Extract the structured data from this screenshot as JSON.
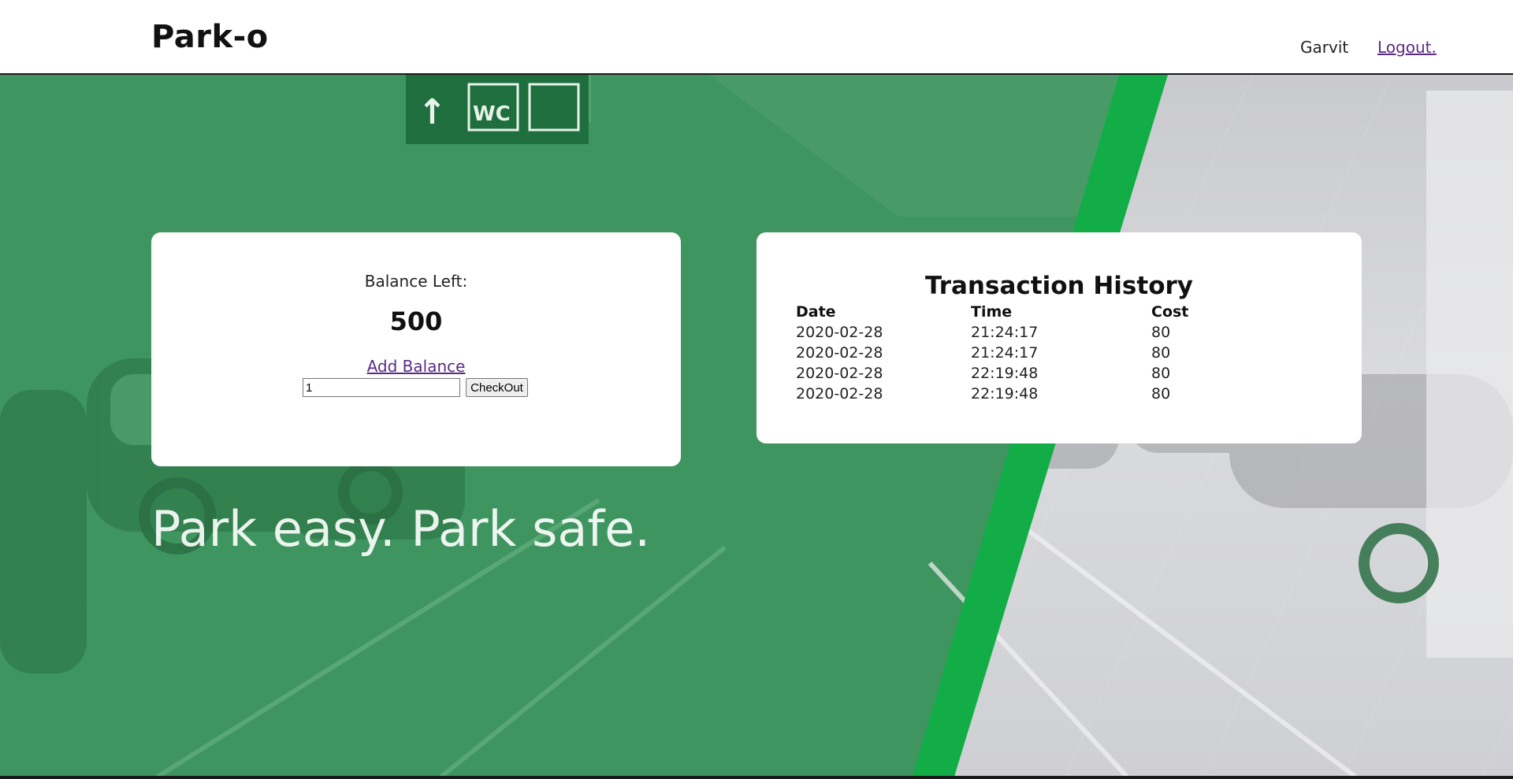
{
  "header": {
    "brand": "Park-o",
    "user_name": "Garvit",
    "logout_label": "Logout."
  },
  "hero": {
    "tagline": "Park easy. Park safe."
  },
  "balance": {
    "label": "Balance Left:",
    "value": "500",
    "add_label": "Add Balance",
    "checkout_input_value": "1",
    "checkout_button_label": "CheckOut"
  },
  "history": {
    "title": "Transaction History",
    "columns": [
      "Date",
      "Time",
      "Cost"
    ],
    "rows": [
      [
        "2020-02-28",
        "21:24:17",
        "80"
      ],
      [
        "2020-02-28",
        "21:24:17",
        "80"
      ],
      [
        "2020-02-28",
        "22:19:48",
        "80"
      ],
      [
        "2020-02-28",
        "22:19:48",
        "80"
      ]
    ]
  },
  "colors": {
    "overlay_green": "#3f955f",
    "stripe_green": "#12ad47",
    "link_purple": "#5b2a86"
  }
}
